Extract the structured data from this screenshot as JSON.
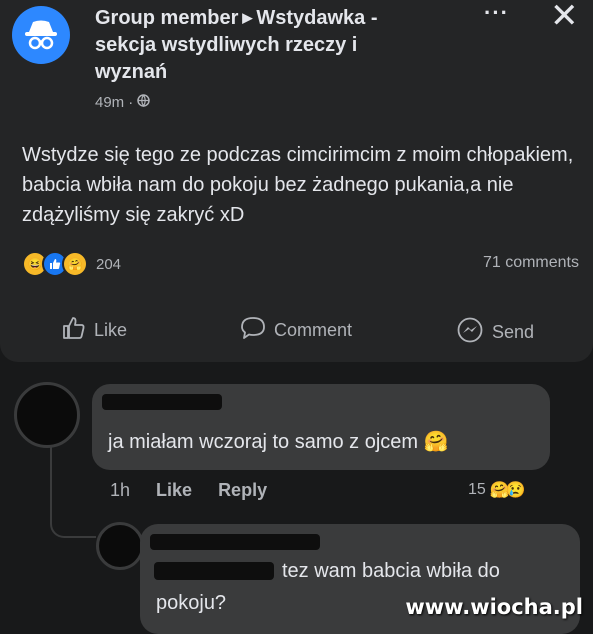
{
  "post": {
    "author": "Group member",
    "group": "Wstydawka - sekcja wstydliwych rzeczy i wyznań",
    "time": "49m",
    "body": "Wstydze się tego ze podczas cimcirimcim z moim chłopakiem, babcia wbiła nam do pokoju bez żadnego pukania,a nie zdążyliśmy się zakryć xD",
    "reaction_count": "204",
    "comments_count": "71 comments",
    "actions": {
      "like": "Like",
      "comment": "Comment",
      "send": "Send"
    }
  },
  "comments": [
    {
      "text": "ja miałam wczoraj to samo z ojcem",
      "time": "1h",
      "like_label": "Like",
      "reply_label": "Reply",
      "reaction_count": "15"
    },
    {
      "text_line1": "tez wam babcia wbiła do",
      "text_line2": "pokoju?"
    }
  ],
  "watermark": "www.wiocha.pl",
  "colors": {
    "background": "#18191a",
    "card": "#242526",
    "bubble": "#3a3b3c",
    "anon_avatar": "#2d88ff"
  }
}
